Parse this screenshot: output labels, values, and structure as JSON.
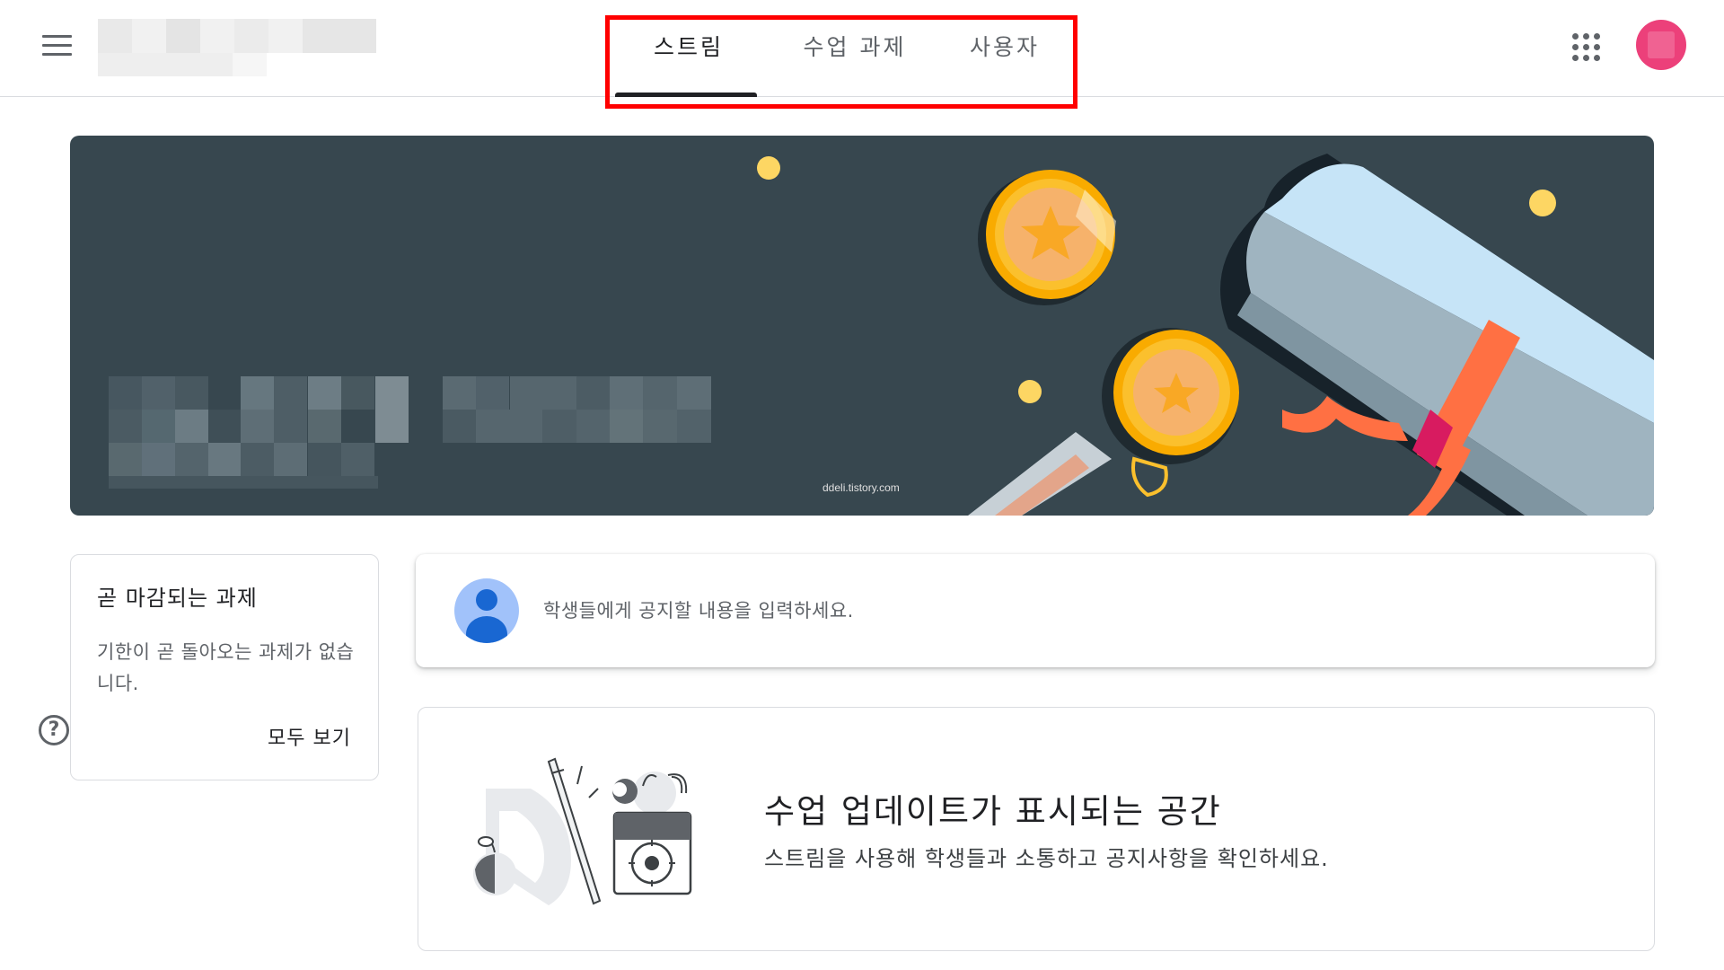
{
  "header": {
    "tabs": [
      {
        "label": "스트림",
        "active": true
      },
      {
        "label": "수업 과제",
        "active": false
      },
      {
        "label": "사용자",
        "active": false
      }
    ],
    "icons": {
      "menu": "menu-icon",
      "apps": "apps-grid-icon",
      "avatar": "user-avatar"
    }
  },
  "banner": {
    "watermark": "ddeli.tistory.com",
    "background_color": "#37474f"
  },
  "upcoming": {
    "title": "곧 마감되는 과제",
    "body": "기한이 곧 돌아오는 과제가 없습니다.",
    "view_all": "모두 보기"
  },
  "announce": {
    "placeholder": "학생들에게 공지할 내용을 입력하세요."
  },
  "empty_state": {
    "title": "수업 업데이트가 표시되는 공간",
    "subtitle": "스트림을 사용해 학생들과 소통하고 공지사항을 확인하세요."
  },
  "colors": {
    "accent_avatar": "#ec407a",
    "tab_active": "#202124",
    "highlight_box": "#ff0000"
  }
}
